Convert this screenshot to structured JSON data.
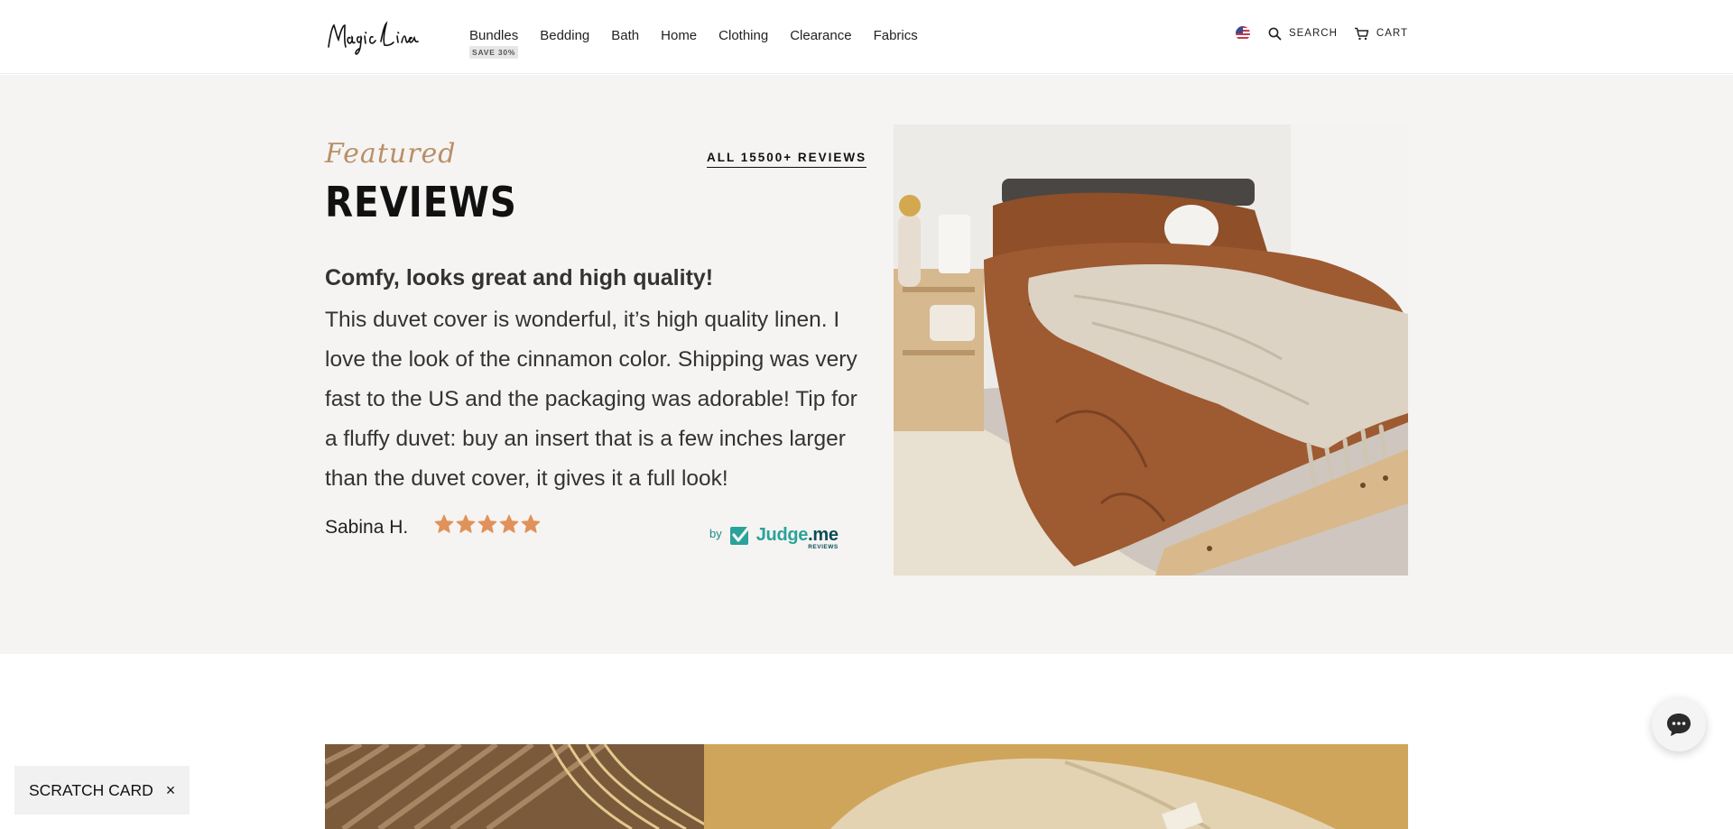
{
  "header": {
    "logo_text": "Magic Linen",
    "nav": [
      {
        "label": "Bundles",
        "badge": "SAVE 30%"
      },
      {
        "label": "Bedding"
      },
      {
        "label": "Bath"
      },
      {
        "label": "Home"
      },
      {
        "label": "Clothing"
      },
      {
        "label": "Clearance"
      },
      {
        "label": "Fabrics"
      }
    ],
    "search_label": "SEARCH",
    "cart_label": "CART",
    "icons": {
      "flag": "us-flag-icon",
      "search": "search-icon",
      "cart": "cart-icon"
    }
  },
  "reviews": {
    "featured_label": "Featured",
    "title": "REVIEWS",
    "all_link": "ALL 15500+ REVIEWS",
    "heading": "Comfy, looks great and high quality!",
    "body": "This duvet cover is wonderful, it’s high quality linen. I love the look of the cinnamon color. Shipping was very fast to the US and the packaging was adorable! Tip for a fluffy duvet: buy an insert that is a few inches larger than the duvet cover, it gives it a full look!",
    "author": "Sabina H.",
    "rating": 5,
    "rating_max": 5,
    "provider_by": "by",
    "provider_name": "Judge",
    "provider_name_suffix": ".me",
    "provider_sub": "REVIEWS"
  },
  "widgets": {
    "scratch_label": "SCRATCH CARD",
    "scratch_close": "×",
    "chat_icon": "chat-icon"
  },
  "colors": {
    "accent": "#b98f67",
    "star": "#e0925a",
    "section_bg": "#f5f4f2",
    "judgeme_teal": "#2aa39b"
  }
}
